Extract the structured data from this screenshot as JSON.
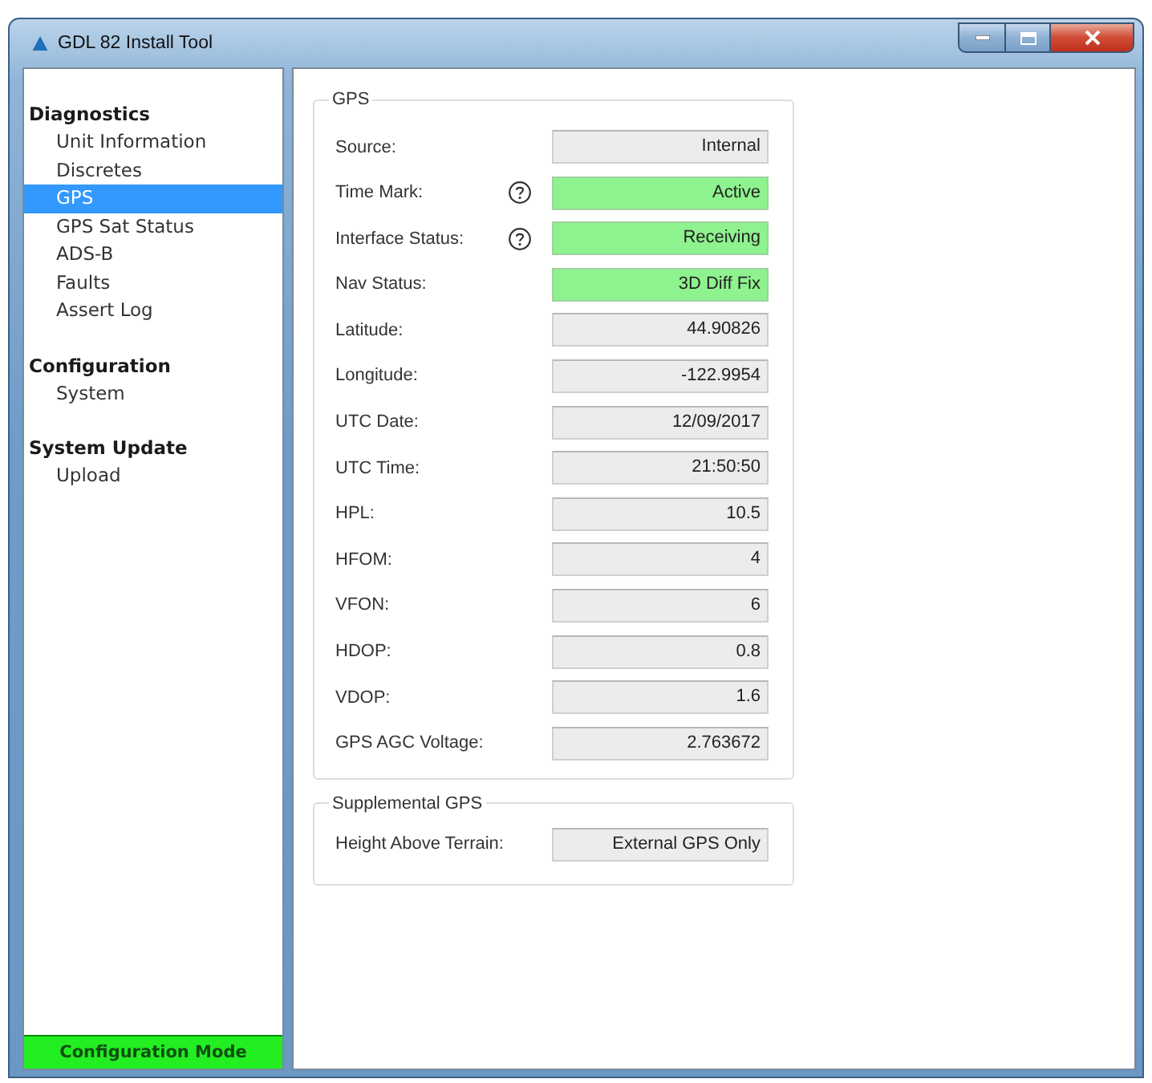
{
  "window": {
    "title": "GDL 82 Install Tool"
  },
  "sidebar": {
    "sections": [
      {
        "heading": "Diagnostics",
        "items": [
          {
            "label": "Unit Information",
            "selected": false
          },
          {
            "label": "Discretes",
            "selected": false
          },
          {
            "label": "GPS",
            "selected": true
          },
          {
            "label": "GPS Sat Status",
            "selected": false
          },
          {
            "label": "ADS-B",
            "selected": false
          },
          {
            "label": "Faults",
            "selected": false
          },
          {
            "label": "Assert Log",
            "selected": false
          }
        ]
      },
      {
        "heading": "Configuration",
        "items": [
          {
            "label": "System",
            "selected": false
          }
        ]
      },
      {
        "heading": "System Update",
        "items": [
          {
            "label": "Upload",
            "selected": false
          }
        ]
      }
    ],
    "mode_label": "Configuration Mode"
  },
  "gps_group": {
    "title": "GPS",
    "rows": [
      {
        "label": "Source:",
        "help": false,
        "value": "Internal",
        "highlighted": false
      },
      {
        "label": "Time Mark:",
        "help": true,
        "value": "Active",
        "highlighted": true
      },
      {
        "label": "Interface Status:",
        "help": true,
        "value": "Receiving",
        "highlighted": true
      },
      {
        "label": "Nav Status:",
        "help": false,
        "value": "3D Diff Fix",
        "highlighted": true
      },
      {
        "label": "Latitude:",
        "help": false,
        "value": "44.90826",
        "highlighted": false
      },
      {
        "label": "Longitude:",
        "help": false,
        "value": "-122.9954",
        "highlighted": false
      },
      {
        "label": "UTC Date:",
        "help": false,
        "value": "12/09/2017",
        "highlighted": false
      },
      {
        "label": "UTC Time:",
        "help": false,
        "value": "21:50:50",
        "highlighted": false
      },
      {
        "label": "HPL:",
        "help": false,
        "value": "10.5",
        "highlighted": false
      },
      {
        "label": "HFOM:",
        "help": false,
        "value": "4",
        "highlighted": false
      },
      {
        "label": "VFON:",
        "help": false,
        "value": "6",
        "highlighted": false
      },
      {
        "label": "HDOP:",
        "help": false,
        "value": "0.8",
        "highlighted": false
      },
      {
        "label": "VDOP:",
        "help": false,
        "value": "1.6",
        "highlighted": false
      },
      {
        "label": "GPS AGC Voltage:",
        "help": false,
        "value": "2.763672",
        "highlighted": false
      }
    ]
  },
  "supplemental_group": {
    "title": "Supplemental GPS",
    "rows": [
      {
        "label": "Height Above Terrain:",
        "help": false,
        "value": "External GPS Only",
        "highlighted": false
      }
    ]
  }
}
